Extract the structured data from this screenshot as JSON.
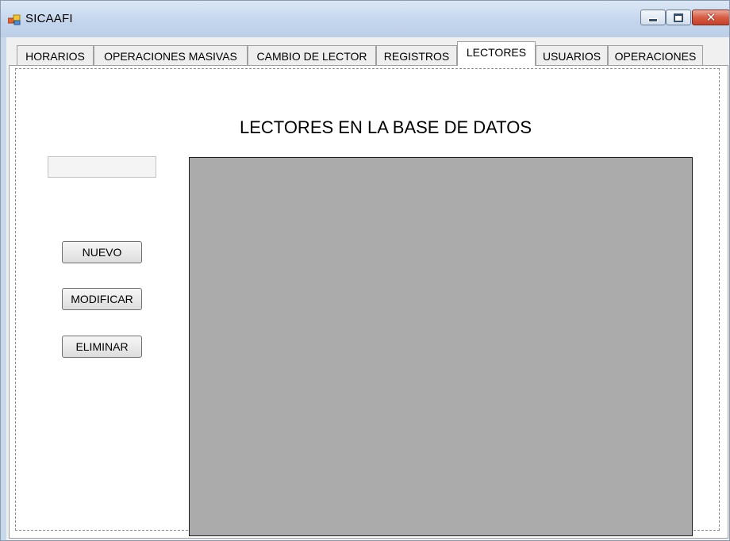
{
  "window": {
    "title": "SICAAFI",
    "icon": "app-window-icon",
    "controls": {
      "minimize": "minimize-icon",
      "maximize": "maximize-icon",
      "close": "close-icon",
      "close_glyph": "✕"
    }
  },
  "tabs": [
    {
      "label": "HORARIOS",
      "active": false
    },
    {
      "label": "OPERACIONES MASIVAS",
      "active": false
    },
    {
      "label": "CAMBIO DE LECTOR",
      "active": false
    },
    {
      "label": "REGISTROS",
      "active": false
    },
    {
      "label": "LECTORES",
      "active": true
    },
    {
      "label": "USUARIOS",
      "active": false
    },
    {
      "label": "OPERACIONES",
      "active": false
    }
  ],
  "lectores_page": {
    "heading": "LECTORES EN LA BASE DE DATOS",
    "input": {
      "value": "",
      "placeholder": ""
    },
    "buttons": {
      "nuevo": "NUEVO",
      "modificar": "MODIFICAR",
      "eliminar": "ELIMINAR"
    }
  },
  "colors": {
    "grid_background": "#ababab",
    "titlebar": "#c9d9ec",
    "close_button": "#d65d43"
  }
}
